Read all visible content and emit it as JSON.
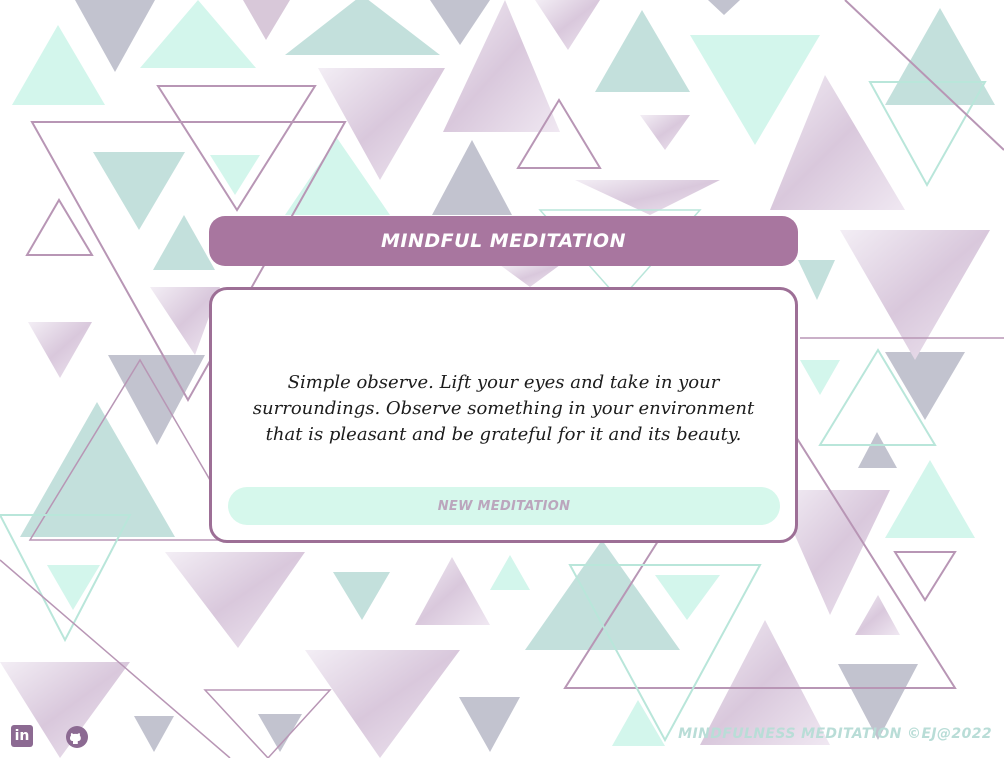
{
  "header": {
    "title": "MINDFUL MEDITATION"
  },
  "meditation": {
    "text": "Simple observe. Lift your eyes and take in your surroundings. Observe something in your environment that is pleasant and be grateful for it and its beauty.",
    "button_label": "NEW MEDITATION"
  },
  "footer": {
    "linkedin_icon": "linkedin-icon",
    "linkedin_glyph": "in",
    "github_icon": "github-icon",
    "credit": "MINDFULNESS MEDITATION ©EJ@2022"
  },
  "colors": {
    "accent_purple": "#a8769f",
    "mint": "#d6f8ec",
    "teal": "#c3e0dc",
    "lavender_gray": "#c2c3cf",
    "text": "#1c1c1c"
  }
}
